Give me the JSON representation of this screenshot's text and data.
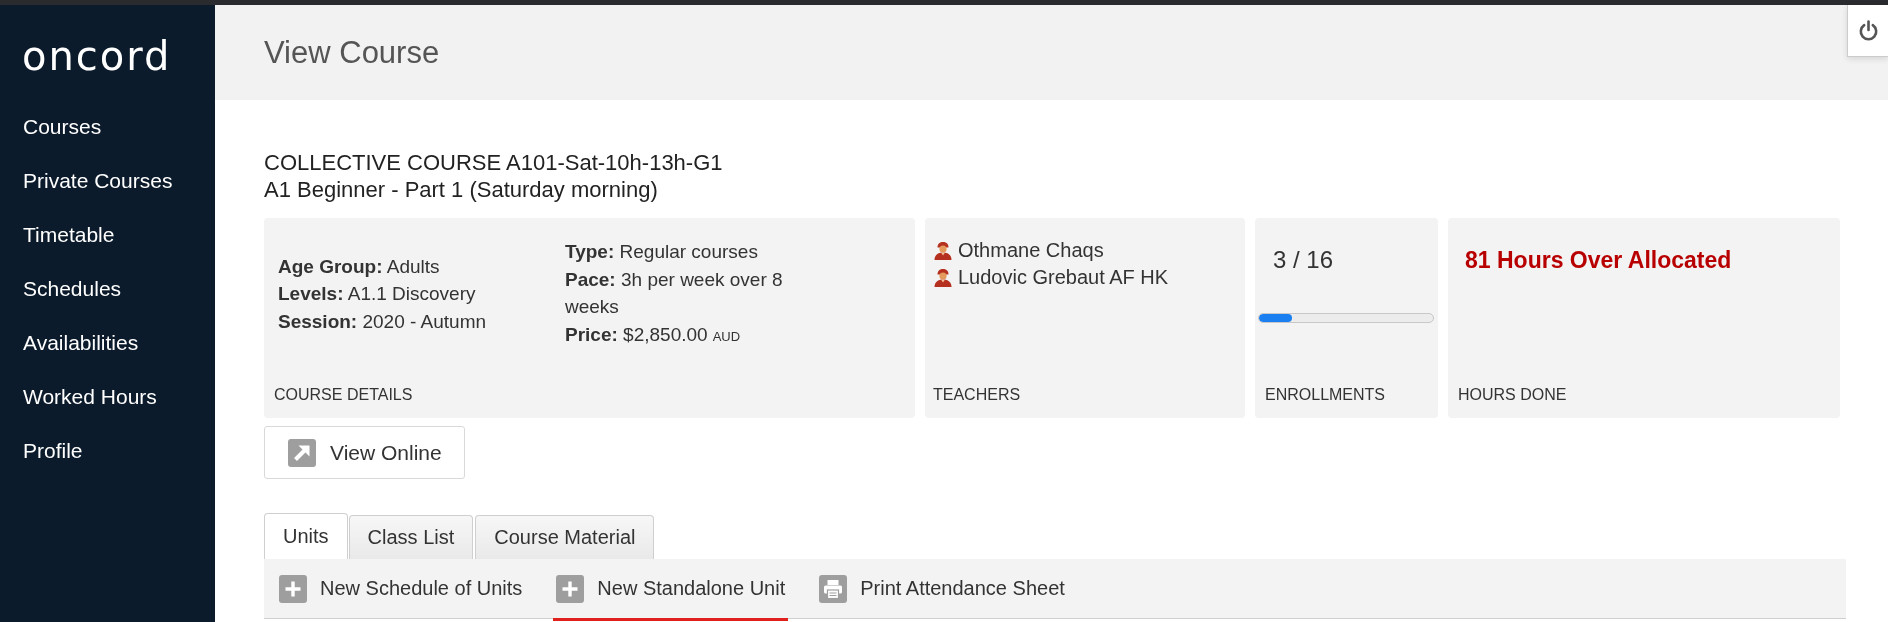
{
  "sidebar": {
    "logo": "oncord",
    "items": [
      {
        "label": "Courses"
      },
      {
        "label": "Private Courses"
      },
      {
        "label": "Timetable"
      },
      {
        "label": "Schedules"
      },
      {
        "label": "Availabilities"
      },
      {
        "label": "Worked Hours"
      },
      {
        "label": "Profile"
      }
    ]
  },
  "header": {
    "title": "View Course"
  },
  "course": {
    "title": "COLLECTIVE COURSE A101-Sat-10h-13h-G1",
    "subtitle": "A1 Beginner - Part 1 (Saturday morning)"
  },
  "cards": [
    {
      "kind": "details",
      "label": "COURSE DETAILS",
      "columns": [
        [
          {
            "text": "**Age Group:** Adults"
          },
          {
            "text": "**Levels:** A1.1 Discovery"
          },
          {
            "text": "**Session:** 2020 - Autumn"
          }
        ],
        [
          {
            "text": "**Type:** Regular courses"
          },
          {
            "text": "**Pace:** 3h per week over 8 weeks"
          },
          {
            "text": "**Price:** $2,850.00",
            "currency": "AUD"
          }
        ]
      ]
    },
    {
      "kind": "people",
      "label": "TEACHERS",
      "people": [
        {
          "name": "Othmane Chaqs"
        },
        {
          "name": "Ludovic Grebaut AF HK"
        }
      ]
    },
    {
      "kind": "progress",
      "label": "ENROLLMENTS",
      "reading": "3 / 16",
      "level": 0.19
    },
    {
      "kind": "alert",
      "label": "HOURS DONE",
      "text": "81 Hours Over Allocated"
    }
  ],
  "view_online_button": {
    "label": "View Online"
  },
  "tabs": [
    {
      "label": "Units",
      "selected": true
    },
    {
      "label": "Class List",
      "selected": false
    },
    {
      "label": "Course Material",
      "selected": false
    }
  ],
  "toolbar": [
    {
      "kind": "add",
      "label": "New Schedule of Units",
      "selected": false
    },
    {
      "kind": "add",
      "label": "New Standalone Unit",
      "selected": true
    },
    {
      "kind": "print",
      "label": "Print Attendance Sheet",
      "selected": false
    }
  ]
}
